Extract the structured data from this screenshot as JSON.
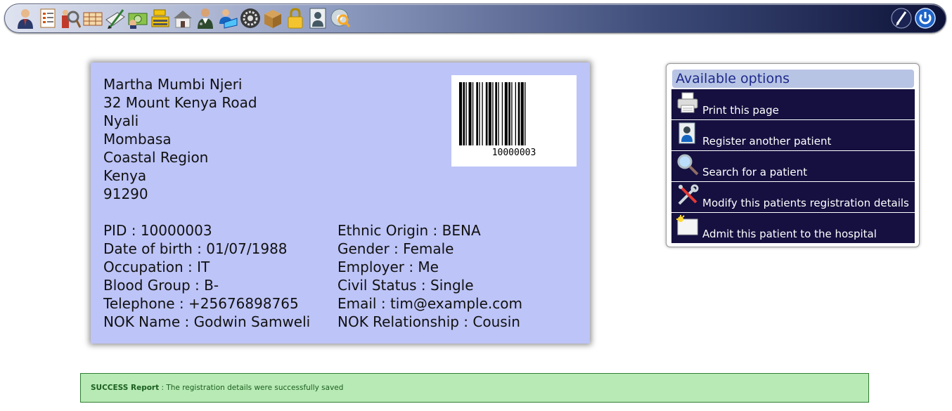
{
  "toolbar": {
    "left_icons": [
      "person-icon",
      "document-list-icon",
      "search-people-icon",
      "spreadsheet-icon",
      "pen-paper-icon",
      "money-icon",
      "cash-register-icon",
      "house-icon",
      "doctor-icon",
      "user-laptop-icon",
      "settings-gear-icon",
      "package-box-icon",
      "padlock-icon",
      "id-card-icon",
      "disc-search-icon"
    ],
    "right_icons": [
      "edit-pen-icon",
      "power-icon"
    ]
  },
  "patient": {
    "name": "Martha Mumbi Njeri",
    "address_line1": "32 Mount Kenya Road",
    "address_line2": "Nyali",
    "city": "Mombasa",
    "region": "Coastal Region",
    "country": "Kenya",
    "postcode": "91290",
    "barcode_number": "10000003",
    "left_fields": [
      "PID : 10000003",
      "Date of birth : 01/07/1988",
      "Occupation : IT",
      "Blood Group : B-",
      "Telephone : +25676898765",
      "NOK Name : Godwin Samweli"
    ],
    "right_fields": [
      "Ethnic Origin : BENA",
      "Gender : Female",
      "Employer : Me",
      "Civil Status : Single",
      "Email : tim@example.com",
      "NOK Relationship : Cousin"
    ]
  },
  "options": {
    "title": "Available options",
    "items": [
      {
        "label": "Print this page",
        "icon": "printer-icon"
      },
      {
        "label": "Register another patient",
        "icon": "register-patient-icon"
      },
      {
        "label": "Search for a patient",
        "icon": "magnifier-icon"
      },
      {
        "label": "Modify this patients registration details",
        "icon": "tools-icon"
      },
      {
        "label": "Admit this patient to the hospital",
        "icon": "admit-sun-icon"
      }
    ]
  },
  "status": {
    "label": "SUCCESS Report",
    "message": " : The registration details were successfully saved"
  },
  "colors": {
    "card_bg": "#bdc4f7",
    "option_bg": "#151040",
    "success_bg": "#b8eab5"
  }
}
